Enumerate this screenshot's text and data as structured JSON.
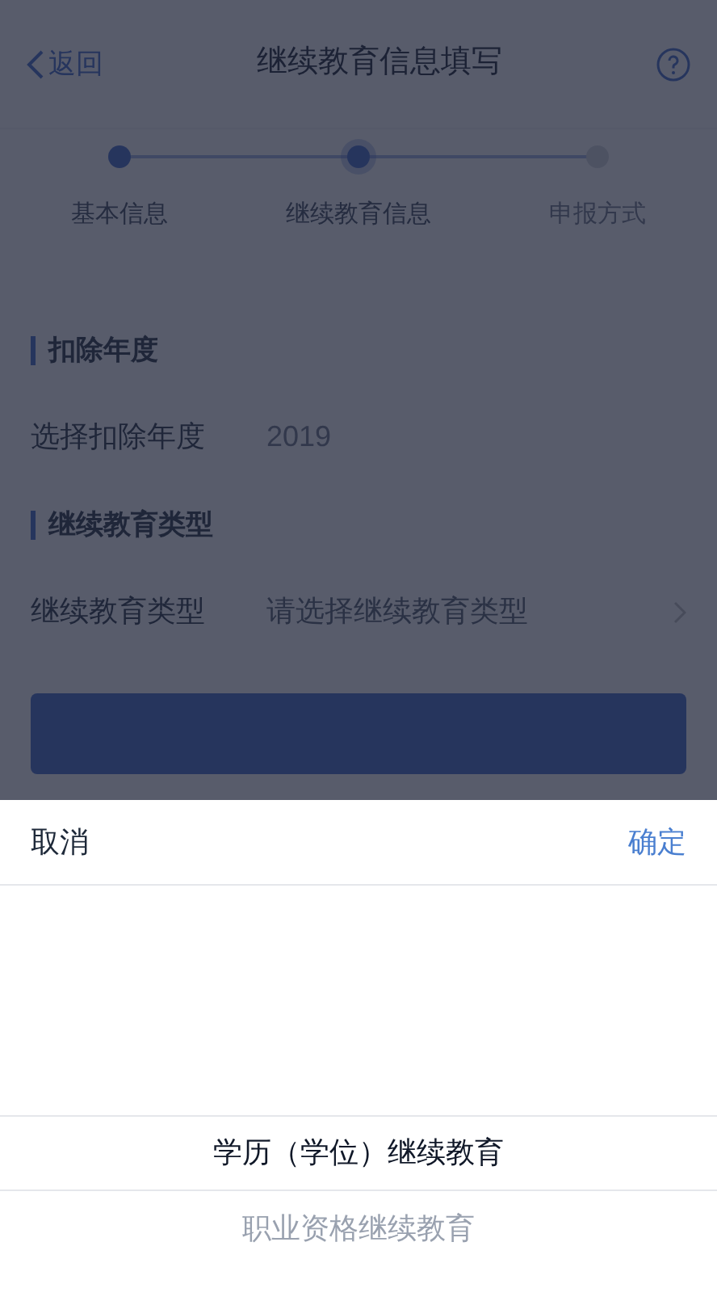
{
  "nav": {
    "back": "返回",
    "title": "继续教育信息填写"
  },
  "steps": [
    {
      "label": "基本信息",
      "kind": "done"
    },
    {
      "label": "继续教育信息",
      "kind": "current"
    },
    {
      "label": "申报方式",
      "kind": "todo"
    }
  ],
  "sections": [
    {
      "title": "扣除年度",
      "field": {
        "label": "选择扣除年度",
        "value": "2019",
        "kind": "value"
      }
    },
    {
      "title": "继续教育类型",
      "field": {
        "label": "继续教育类型",
        "placeholder": "请选择继续教育类型",
        "kind": "select"
      }
    }
  ],
  "picker": {
    "cancel": "取消",
    "confirm": "确定",
    "options": [
      {
        "label": "学历（学位）继续教育",
        "selected": true
      },
      {
        "label": "职业资格继续教育",
        "selected": false
      }
    ]
  }
}
